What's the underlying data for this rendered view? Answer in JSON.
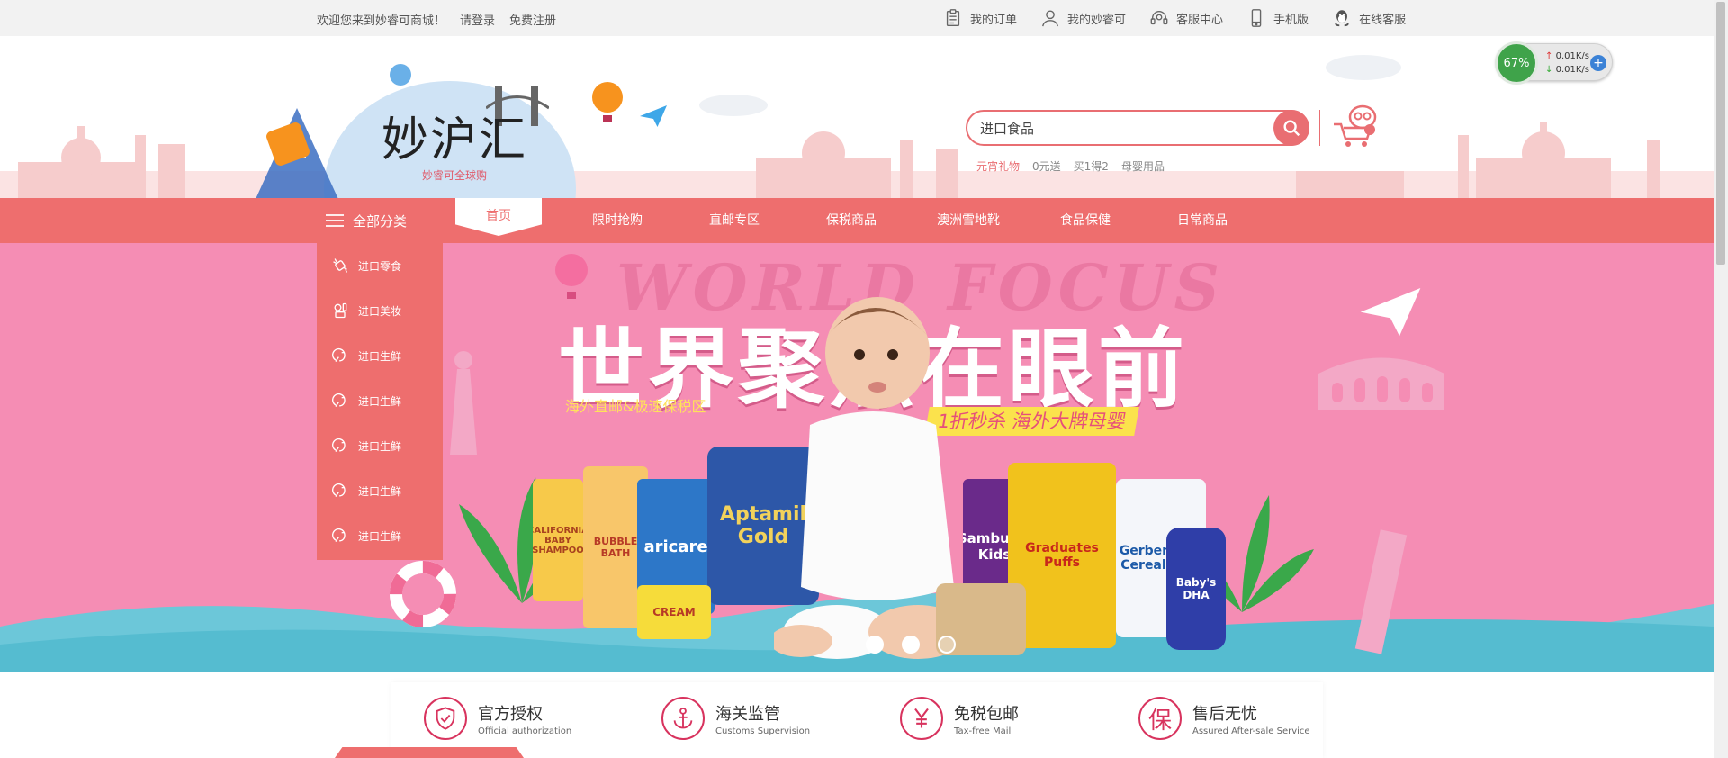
{
  "topbar": {
    "welcome": "欢迎您来到妙睿可商城！",
    "login": "请登录",
    "register": "免费注册",
    "links": [
      {
        "label": "我的订单",
        "icon": "clipboard-icon"
      },
      {
        "label": "我的妙睿可",
        "icon": "user-icon"
      },
      {
        "label": "客服中心",
        "icon": "headset-icon"
      },
      {
        "label": "手机版",
        "icon": "phone-icon"
      },
      {
        "label": "在线客服",
        "icon": "qq-icon"
      }
    ]
  },
  "header": {
    "logo_mark": "妙沪汇",
    "slogan": "——妙睿可全球购——",
    "search_placeholder": "进口食品",
    "hot_searches": [
      "元宵礼物",
      "0元送",
      "买1得2",
      "母婴用品"
    ]
  },
  "speed_widget": {
    "percent": "67%",
    "up": "0.01K/s",
    "down": "0.01K/s"
  },
  "nav": {
    "all_categories": "全部分类",
    "items": [
      "首页",
      "限时抢购",
      "直邮专区",
      "保税商品",
      "澳洲雪地靴",
      "食品保健",
      "日常商品"
    ]
  },
  "sidemenu": {
    "items": [
      "进口零食",
      "进口美妆",
      "进口生鲜",
      "进口生鲜",
      "进口生鲜",
      "进口生鲜",
      "进口生鲜"
    ]
  },
  "banner": {
    "watermark": "WORLD FOCUS",
    "headline": "世界聚焦在眼前",
    "subline": "海外直邮&极速保税区",
    "promo": "1折秒杀 海外大牌母婴",
    "products": [
      "CALIFORNIA BABY SHAMPOO",
      "BUBBLE BATH",
      "aricare",
      "Aptamil Gold",
      "CREAM",
      "Sambucol Kids",
      "Graduates Puffs",
      "Gerber Rice Cereal DHA",
      "Baby's DHA"
    ],
    "slide_count": 3,
    "active_slide": 1
  },
  "features": [
    {
      "title": "官方授权",
      "subtitle": "Official authorization",
      "icon": "shield-check-icon"
    },
    {
      "title": "海关监管",
      "subtitle": "Customs Supervision",
      "icon": "anchor-icon"
    },
    {
      "title": "免税包邮",
      "subtitle": "Tax-free Mail",
      "icon": "yen-icon"
    },
    {
      "title": "售后无忧",
      "subtitle": "Assured After-sale Service",
      "icon": "bao-icon"
    }
  ],
  "colors": {
    "brand": "#ee6e6e",
    "banner_bg": "#f58db4",
    "accent_pink": "#d8335e",
    "promo_yellow": "#fbe24c"
  }
}
